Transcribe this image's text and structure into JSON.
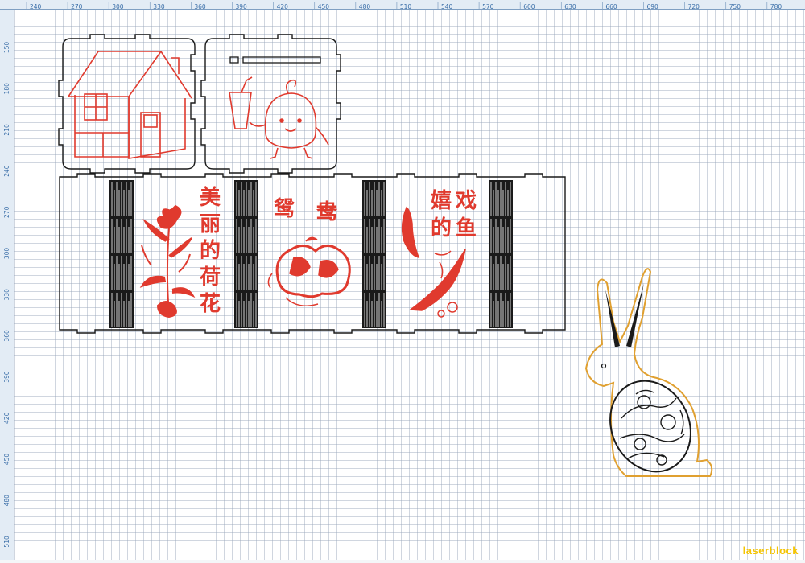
{
  "ruler": {
    "top_ticks": [
      "240",
      "270",
      "300",
      "330",
      "360",
      "390",
      "420",
      "450",
      "480",
      "510",
      "540",
      "570",
      "600",
      "630",
      "660",
      "690",
      "720",
      "750",
      "780"
    ],
    "left_ticks": [
      "150",
      "180",
      "210",
      "240",
      "270",
      "300",
      "330",
      "360",
      "390",
      "420",
      "450",
      "480",
      "510"
    ]
  },
  "panels": {
    "lotus_text": [
      "美",
      "丽",
      "的",
      "荷",
      "花"
    ],
    "ducks_text": [
      "鸳",
      "鸯"
    ],
    "fish_text_col1": [
      "嬉",
      "的"
    ],
    "fish_text_col2": [
      "戏",
      "鱼"
    ]
  },
  "colors": {
    "cut_line": "#1a1a1a",
    "engrave": "#e03a2e",
    "rabbit_outline": "#e0a030",
    "ruler_text": "#3a6ea8",
    "watermark": "#f5c400"
  },
  "watermark": "laserblock"
}
